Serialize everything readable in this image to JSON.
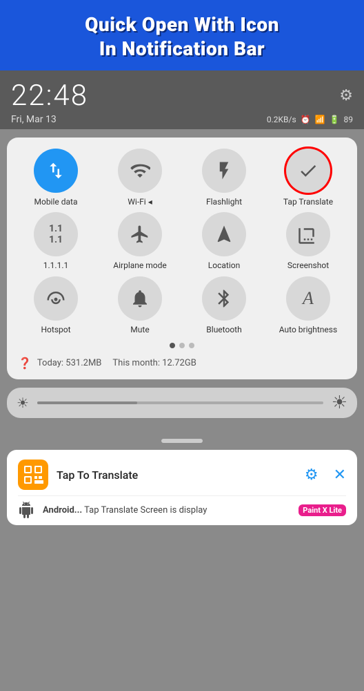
{
  "banner": {
    "title_line1": "Quick Open With Icon",
    "title_line2": "In Notification Bar"
  },
  "status": {
    "time": "22:48",
    "date": "Fri, Mar 13",
    "speed": "0.2KB/s",
    "battery": "89"
  },
  "tiles": [
    {
      "id": "mobile-data",
      "label": "Mobile data",
      "icon": "⇅",
      "active": true
    },
    {
      "id": "wifi",
      "label": "Wi-Fi",
      "icon": "wifi",
      "active": false
    },
    {
      "id": "flashlight",
      "label": "Flashlight",
      "icon": "flashlight",
      "active": false
    },
    {
      "id": "tap-translate",
      "label": "Tap Translate",
      "icon": "check",
      "active": false,
      "highlighted": true
    },
    {
      "id": "dns",
      "label": "1.1.1.1",
      "icon": "1¹",
      "active": false
    },
    {
      "id": "airplane",
      "label": "Airplane mode",
      "icon": "airplane",
      "active": false
    },
    {
      "id": "location",
      "label": "Location",
      "icon": "location",
      "active": false
    },
    {
      "id": "screenshot",
      "label": "Screenshot",
      "icon": "screenshot",
      "active": false
    },
    {
      "id": "hotspot",
      "label": "Hotspot",
      "icon": "hotspot",
      "active": false
    },
    {
      "id": "mute",
      "label": "Mute",
      "icon": "bell",
      "active": false
    },
    {
      "id": "bluetooth",
      "label": "Bluetooth",
      "icon": "bluetooth",
      "active": false
    },
    {
      "id": "auto-brightness",
      "label": "Auto brightness",
      "icon": "A",
      "active": false
    }
  ],
  "pagination": {
    "total": 3,
    "active": 0
  },
  "data_usage": {
    "today": "Today: 531.2MB",
    "month": "This month: 12.72GB"
  },
  "notification": {
    "app_name": "Tap To Translate",
    "second_row_label": "Android...",
    "second_row_text": "Tap Translate Screen is display",
    "badge": "Paint X Lite"
  }
}
